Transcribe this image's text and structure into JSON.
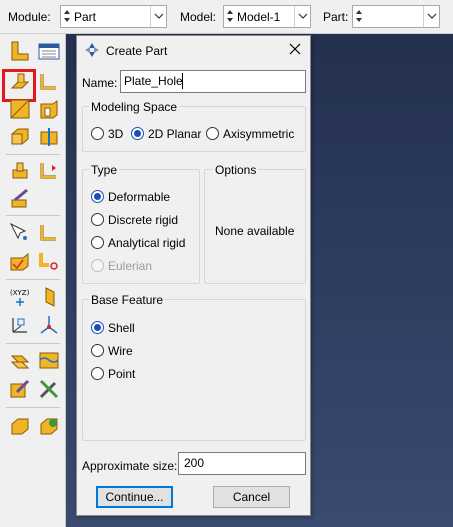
{
  "topbar": {
    "module_label": "Module:",
    "module_value": "Part",
    "model_label": "Model:",
    "model_value": "Model-1",
    "part_label": "Part:",
    "part_value": ""
  },
  "toolbox": {
    "highlighted_tool": "create-part"
  },
  "dialog": {
    "title": "Create Part",
    "name_label": "Name:",
    "name_value": "Plate_Hole",
    "modeling_space": {
      "title": "Modeling Space",
      "options": [
        "3D",
        "2D Planar",
        "Axisymmetric"
      ],
      "selected": "2D Planar"
    },
    "type": {
      "title": "Type",
      "options": [
        "Deformable",
        "Discrete rigid",
        "Analytical rigid",
        "Eulerian"
      ],
      "selected": "Deformable",
      "disabled": [
        "Eulerian"
      ]
    },
    "options_group": {
      "title": "Options",
      "text": "None available"
    },
    "base_feature": {
      "title": "Base Feature",
      "options": [
        "Shell",
        "Wire",
        "Point"
      ],
      "selected": "Shell"
    },
    "approx_size_label": "Approximate size:",
    "approx_size_value": "200",
    "continue_label": "Continue...",
    "cancel_label": "Cancel"
  },
  "colors": {
    "highlight": "#e0191c",
    "radio_selected": "#1a4fb8",
    "viewport_top": "#23304f",
    "viewport_bottom": "#3a4a70"
  }
}
